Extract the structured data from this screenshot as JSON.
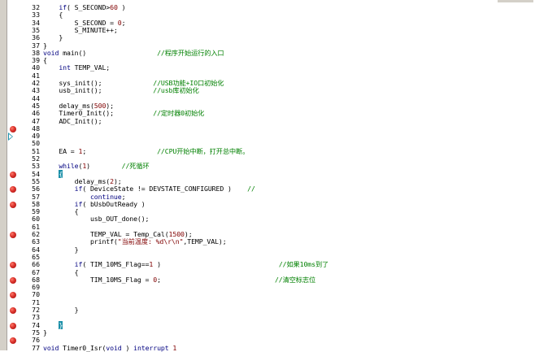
{
  "editor": {
    "lines": [
      {
        "n": "32",
        "bp": false,
        "code": [
          [
            "",
            "    "
          ],
          [
            "kw",
            "if"
          ],
          [
            "",
            "( S_SECOND>"
          ],
          [
            "num",
            "60"
          ],
          [
            "",
            " )"
          ]
        ]
      },
      {
        "n": "33",
        "bp": false,
        "code": [
          [
            "",
            "    {"
          ]
        ]
      },
      {
        "n": "34",
        "bp": false,
        "code": [
          [
            "",
            "        S_SECOND = "
          ],
          [
            "num",
            "0"
          ],
          [
            "",
            ";"
          ]
        ]
      },
      {
        "n": "35",
        "bp": false,
        "code": [
          [
            "",
            "        S_MINUTE++;"
          ]
        ]
      },
      {
        "n": "36",
        "bp": false,
        "code": [
          [
            "",
            "    }"
          ]
        ]
      },
      {
        "n": "37",
        "bp": false,
        "code": [
          [
            "",
            "}"
          ]
        ]
      },
      {
        "n": "38",
        "bp": false,
        "code": [
          [
            "kw",
            "void"
          ],
          [
            "",
            " main()                  "
          ],
          [
            "cm",
            "//程序开始运行的入口"
          ]
        ]
      },
      {
        "n": "39",
        "bp": false,
        "code": [
          [
            "",
            "{"
          ]
        ]
      },
      {
        "n": "40",
        "bp": false,
        "code": [
          [
            "",
            "    "
          ],
          [
            "kw",
            "int"
          ],
          [
            "",
            " TEMP_VAL;"
          ]
        ]
      },
      {
        "n": "41",
        "bp": false,
        "code": [
          [
            "",
            ""
          ]
        ]
      },
      {
        "n": "42",
        "bp": false,
        "code": [
          [
            "",
            "    sys_init();             "
          ],
          [
            "cm",
            "//USB功能+IO口初始化"
          ]
        ]
      },
      {
        "n": "43",
        "bp": false,
        "code": [
          [
            "",
            "    usb_init();             "
          ],
          [
            "cm",
            "//usb库初始化"
          ]
        ]
      },
      {
        "n": "44",
        "bp": false,
        "code": [
          [
            "",
            ""
          ]
        ]
      },
      {
        "n": "45",
        "bp": false,
        "code": [
          [
            "",
            "    delay_ms("
          ],
          [
            "num",
            "500"
          ],
          [
            "",
            ");"
          ]
        ]
      },
      {
        "n": "46",
        "bp": false,
        "code": [
          [
            "",
            "    Timer0_Init();          "
          ],
          [
            "cm",
            "//定时器0初始化"
          ]
        ]
      },
      {
        "n": "47",
        "bp": false,
        "code": [
          [
            "",
            "    ADC_Init();"
          ]
        ]
      },
      {
        "n": "48",
        "bp": true,
        "code": [
          [
            "",
            ""
          ]
        ]
      },
      {
        "n": "49",
        "bp": false,
        "arrow": true,
        "code": [
          [
            "",
            ""
          ]
        ]
      },
      {
        "n": "50",
        "bp": false,
        "code": [
          [
            "",
            ""
          ]
        ]
      },
      {
        "n": "51",
        "bp": false,
        "code": [
          [
            "",
            "    EA = "
          ],
          [
            "num",
            "1"
          ],
          [
            "",
            ";                  "
          ],
          [
            "cm",
            "//CPU开始中断，打开总中断。"
          ]
        ]
      },
      {
        "n": "52",
        "bp": false,
        "code": [
          [
            "",
            ""
          ]
        ]
      },
      {
        "n": "53",
        "bp": false,
        "code": [
          [
            "",
            "    "
          ],
          [
            "kw",
            "while"
          ],
          [
            "",
            "("
          ],
          [
            "num",
            "1"
          ],
          [
            "",
            ")        "
          ],
          [
            "cm",
            "//死循环"
          ]
        ]
      },
      {
        "n": "54",
        "bp": true,
        "code": [
          [
            "",
            "    "
          ],
          [
            "hl",
            "{"
          ]
        ]
      },
      {
        "n": "55",
        "bp": false,
        "code": [
          [
            "",
            "        delay_ms("
          ],
          [
            "num",
            "2"
          ],
          [
            "",
            ");"
          ]
        ]
      },
      {
        "n": "56",
        "bp": true,
        "code": [
          [
            "",
            "        "
          ],
          [
            "kw",
            "if"
          ],
          [
            "",
            "( DeviceState != DEVSTATE_CONFIGURED )    "
          ],
          [
            "cm",
            "//"
          ]
        ]
      },
      {
        "n": "57",
        "bp": false,
        "code": [
          [
            "",
            "            "
          ],
          [
            "kw",
            "continue"
          ],
          [
            "",
            ";"
          ]
        ]
      },
      {
        "n": "58",
        "bp": true,
        "code": [
          [
            "",
            "        "
          ],
          [
            "kw",
            "if"
          ],
          [
            "",
            "( bUsbOutReady )"
          ]
        ]
      },
      {
        "n": "59",
        "bp": false,
        "code": [
          [
            "",
            "        {"
          ]
        ]
      },
      {
        "n": "60",
        "bp": false,
        "code": [
          [
            "",
            "            usb_OUT_done();"
          ]
        ]
      },
      {
        "n": "61",
        "bp": false,
        "code": [
          [
            "",
            ""
          ]
        ]
      },
      {
        "n": "62",
        "bp": true,
        "code": [
          [
            "",
            "            TEMP_VAL = Temp_Cal("
          ],
          [
            "num",
            "1500"
          ],
          [
            "",
            ");"
          ]
        ]
      },
      {
        "n": "63",
        "bp": false,
        "code": [
          [
            "",
            "            printf("
          ],
          [
            "str",
            "\"当前温度: %d\\r\\n\""
          ],
          [
            "",
            ",TEMP_VAL);"
          ]
        ]
      },
      {
        "n": "64",
        "bp": false,
        "code": [
          [
            "",
            "        }"
          ]
        ]
      },
      {
        "n": "65",
        "bp": false,
        "code": [
          [
            "",
            ""
          ]
        ]
      },
      {
        "n": "66",
        "bp": true,
        "code": [
          [
            "",
            "        "
          ],
          [
            "kw",
            "if"
          ],
          [
            "",
            "( TIM_10MS_Flag=="
          ],
          [
            "num",
            "1"
          ],
          [
            "",
            " )                              "
          ],
          [
            "cm",
            "//如果10ms到了"
          ]
        ]
      },
      {
        "n": "67",
        "bp": false,
        "code": [
          [
            "",
            "        {"
          ]
        ]
      },
      {
        "n": "68",
        "bp": true,
        "code": [
          [
            "",
            "            TIM_10MS_Flag = "
          ],
          [
            "num",
            "0"
          ],
          [
            "",
            ";                             "
          ],
          [
            "cm",
            "//清空标志位"
          ]
        ]
      },
      {
        "n": "69",
        "bp": false,
        "code": [
          [
            "",
            ""
          ]
        ]
      },
      {
        "n": "70",
        "bp": true,
        "code": [
          [
            "",
            ""
          ]
        ]
      },
      {
        "n": "71",
        "bp": false,
        "code": [
          [
            "",
            ""
          ]
        ]
      },
      {
        "n": "72",
        "bp": true,
        "code": [
          [
            "",
            "        }"
          ]
        ]
      },
      {
        "n": "73",
        "bp": false,
        "code": [
          [
            "",
            ""
          ]
        ]
      },
      {
        "n": "74",
        "bp": true,
        "code": [
          [
            "",
            "    "
          ],
          [
            "hl",
            "}"
          ]
        ]
      },
      {
        "n": "75",
        "bp": false,
        "code": [
          [
            "",
            "}"
          ]
        ]
      },
      {
        "n": "76",
        "bp": true,
        "code": [
          [
            "",
            ""
          ]
        ]
      },
      {
        "n": "77",
        "bp": false,
        "code": [
          [
            "kw",
            "void"
          ],
          [
            "",
            " Timer0_Isr("
          ],
          [
            "kw",
            "void"
          ],
          [
            "",
            " ) "
          ],
          [
            "kw",
            "interrupt"
          ],
          [
            "",
            " "
          ],
          [
            "num",
            "1"
          ]
        ]
      }
    ],
    "icons": {
      "breakpoint": "breakpoint-icon",
      "current": "execution-arrow-icon"
    }
  }
}
